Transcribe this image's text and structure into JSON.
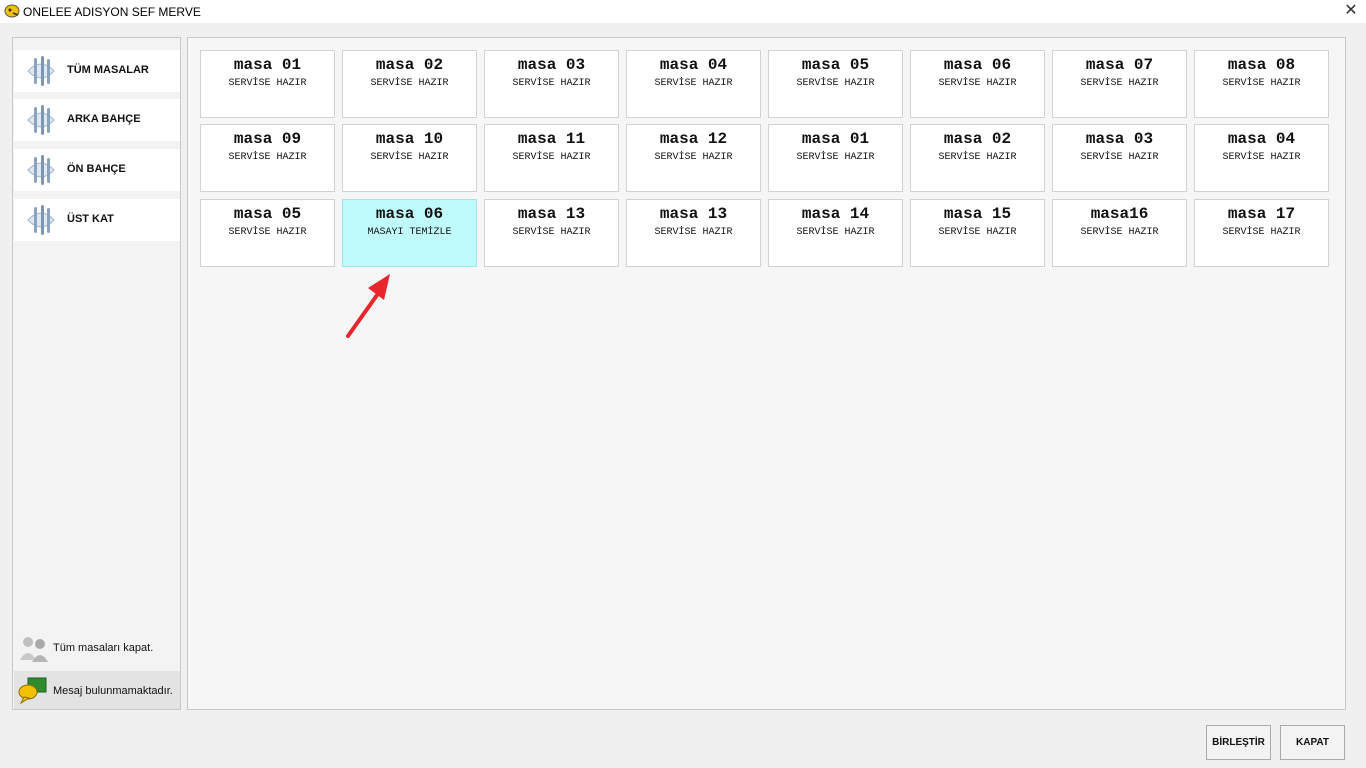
{
  "window": {
    "title": "ONELEE ADISYON SEF MERVE",
    "close_label": "✕"
  },
  "sidebar": {
    "items": [
      {
        "label": "TÜM MASALAR",
        "icon": "cutlery-icon"
      },
      {
        "label": "ARKA BAHÇE",
        "icon": "cutlery-icon"
      },
      {
        "label": "ÖN BAHÇE",
        "icon": "cutlery-icon"
      },
      {
        "label": "ÜST KAT",
        "icon": "cutlery-icon"
      }
    ],
    "close_all": "Tüm masaları kapat.",
    "message": "Mesaj bulunmamaktadır."
  },
  "tables": [
    {
      "name": "masa 01",
      "status": "SERVİSE HAZIR"
    },
    {
      "name": "masa 02",
      "status": "SERVİSE HAZIR"
    },
    {
      "name": "masa 03",
      "status": "SERVİSE HAZIR"
    },
    {
      "name": "masa 04",
      "status": "SERVİSE HAZIR"
    },
    {
      "name": "masa 05",
      "status": "SERVİSE HAZIR"
    },
    {
      "name": "masa 06",
      "status": "SERVİSE HAZIR"
    },
    {
      "name": "masa 07",
      "status": "SERVİSE HAZIR"
    },
    {
      "name": "masa 08",
      "status": "SERVİSE HAZIR"
    },
    {
      "name": "masa 09",
      "status": "SERVİSE HAZIR"
    },
    {
      "name": "masa 10",
      "status": "SERVİSE HAZIR"
    },
    {
      "name": "masa 11",
      "status": "SERVİSE HAZIR"
    },
    {
      "name": "masa 12",
      "status": "SERVİSE HAZIR"
    },
    {
      "name": "masa 01",
      "status": "SERVİSE HAZIR"
    },
    {
      "name": "masa 02",
      "status": "SERVİSE HAZIR"
    },
    {
      "name": "masa 03",
      "status": "SERVİSE HAZIR"
    },
    {
      "name": "masa 04",
      "status": "SERVİSE HAZIR"
    },
    {
      "name": "masa 05",
      "status": "SERVİSE HAZIR"
    },
    {
      "name": "masa 06",
      "status": "MASAYI TEMİZLE"
    },
    {
      "name": "masa 13",
      "status": "SERVİSE HAZIR"
    },
    {
      "name": "masa 13",
      "status": "SERVİSE HAZIR"
    },
    {
      "name": "masa 14",
      "status": "SERVİSE HAZIR"
    },
    {
      "name": "masa 15",
      "status": "SERVİSE HAZIR"
    },
    {
      "name": "masa16",
      "status": "SERVİSE HAZIR"
    },
    {
      "name": "masa 17",
      "status": "SERVİSE HAZIR"
    }
  ],
  "colors": {
    "active_table": "#c0fbfb",
    "arrow": "#e8262b"
  },
  "buttons": {
    "merge": "BİRLEŞTİR",
    "close": "KAPAT"
  }
}
